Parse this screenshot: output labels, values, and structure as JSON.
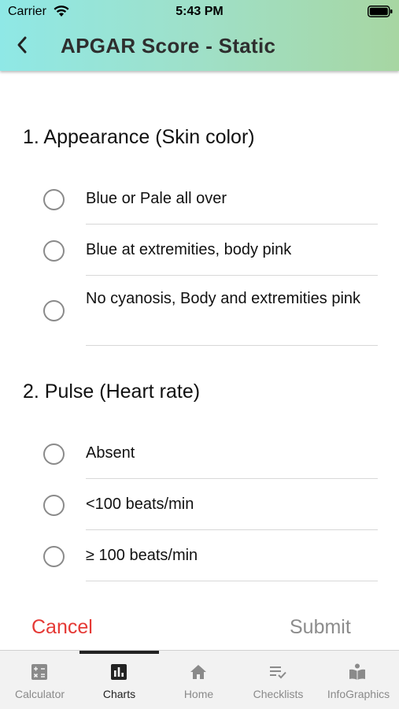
{
  "status_bar": {
    "carrier": "Carrier",
    "time": "5:43 PM"
  },
  "nav": {
    "title": "APGAR Score - Static",
    "back_icon": "chevron-left-icon"
  },
  "questions": [
    {
      "title": "1. Appearance (Skin color)",
      "options": [
        {
          "label": "Blue or Pale all over",
          "selected": false
        },
        {
          "label": "Blue at extremities, body pink",
          "selected": false
        },
        {
          "label": "No cyanosis, Body and extremities pink",
          "selected": false
        }
      ]
    },
    {
      "title": "2. Pulse (Heart rate)",
      "options": [
        {
          "label": "Absent",
          "selected": false
        },
        {
          "label": "<100 beats/min",
          "selected": false
        },
        {
          "label": "≥ 100 beats/min",
          "selected": false
        }
      ]
    }
  ],
  "actions": {
    "cancel_label": "Cancel",
    "submit_label": "Submit"
  },
  "colors": {
    "cancel": "#e53935",
    "submit_disabled": "#8c8c8c",
    "header_start": "#8fe8e6",
    "header_end": "#a7d6a2"
  },
  "tabs": [
    {
      "label": "Calculator",
      "icon": "calculator-icon",
      "active": false
    },
    {
      "label": "Charts",
      "icon": "bar-chart-icon",
      "active": true
    },
    {
      "label": "Home",
      "icon": "home-icon",
      "active": false
    },
    {
      "label": "Checklists",
      "icon": "checklist-icon",
      "active": false
    },
    {
      "label": "InfoGraphics",
      "icon": "book-reader-icon",
      "active": false
    }
  ]
}
